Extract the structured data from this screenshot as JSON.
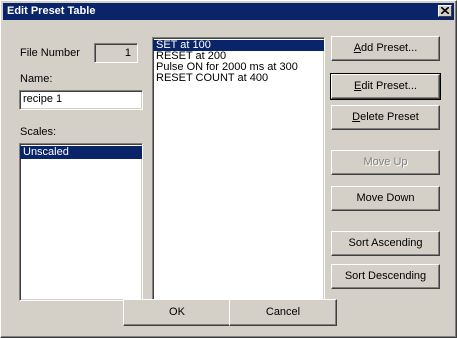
{
  "window": {
    "title": "Edit Preset Table"
  },
  "left": {
    "file_number_label": "File Number",
    "file_number_value": "1",
    "name_label": "Name:",
    "name_value": "recipe 1",
    "scales_label": "Scales:",
    "scales_items": [
      "Unscaled"
    ]
  },
  "presets": {
    "items": [
      "SET at 100",
      "RESET at 200",
      "Pulse ON for 2000 ms at 300",
      "RESET COUNT at 400"
    ]
  },
  "buttons": {
    "add_preset": {
      "first": "A",
      "rest": "dd Preset..."
    },
    "edit_preset": {
      "first": "E",
      "rest": "dit Preset..."
    },
    "delete_preset": {
      "first": "D",
      "rest": "elete Preset"
    },
    "move_up": "Move Up",
    "move_down": "Move Down",
    "sort_ascending": "Sort Ascending",
    "sort_descending": "Sort Descending",
    "ok": "OK",
    "cancel": "Cancel"
  }
}
